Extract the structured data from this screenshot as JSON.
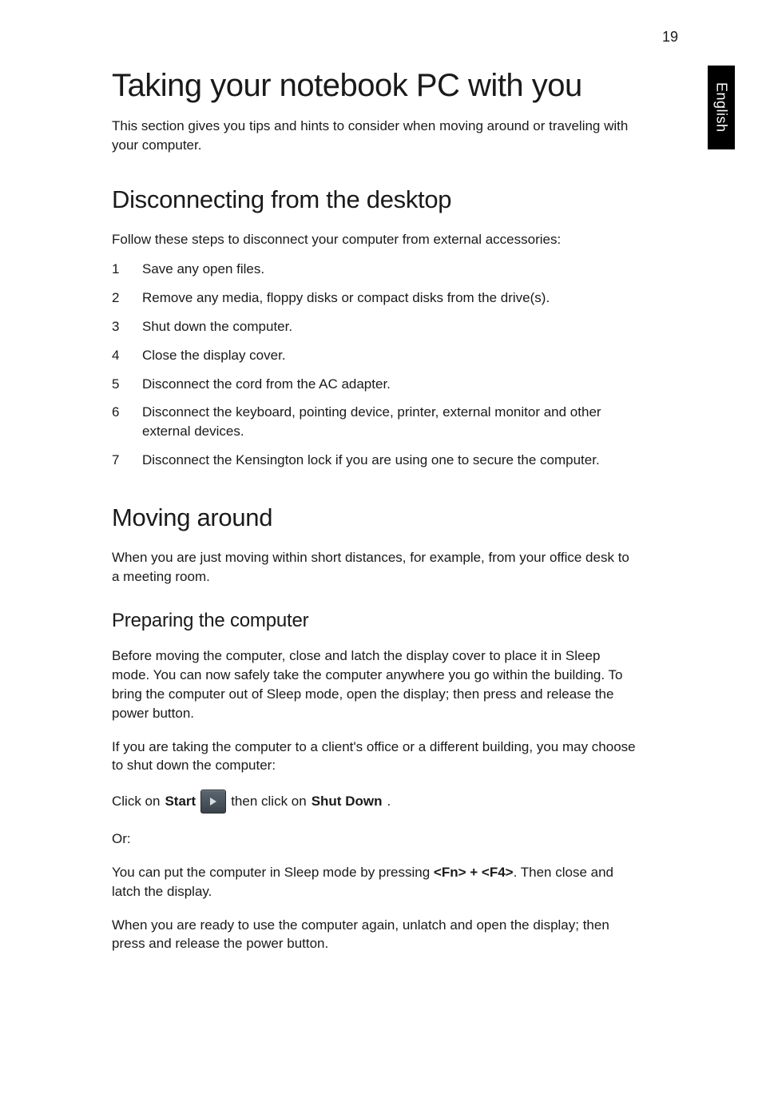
{
  "page_number": "19",
  "side_tab": "English",
  "h1": "Taking your notebook PC with you",
  "intro": "This section gives you tips and hints to consider when moving around or traveling with your computer.",
  "section1": {
    "heading": "Disconnecting from the desktop",
    "lead": "Follow these steps to disconnect your computer from external accessories:",
    "steps": [
      "Save any open files.",
      "Remove any media, floppy disks or compact disks from the drive(s).",
      "Shut down the computer.",
      "Close the display cover.",
      "Disconnect the cord from the AC adapter.",
      "Disconnect the keyboard, pointing device, printer, external monitor and other external devices.",
      "Disconnect the Kensington lock if you are using one to secure the computer."
    ]
  },
  "section2": {
    "heading": "Moving around",
    "lead": "When you are just moving within short distances, for example, from your office desk to a meeting room.",
    "sub": {
      "heading": "Preparing the computer",
      "p1": "Before moving the computer, close and latch the display cover to place it in Sleep mode. You can now safely take the computer anywhere you go within the building. To bring the computer out of Sleep mode, open the display; then press and release the power button.",
      "p2": "If you are taking the computer to a client's office or a different building, you may choose to shut down the computer:",
      "click_on": "Click on ",
      "start_label": "Start",
      "then_click": " then click on ",
      "shutdown_label": "Shut Down",
      "period": ".",
      "or": "Or:",
      "p3_pre": "You can put the computer in Sleep mode by pressing ",
      "fn_key": "<Fn> + <F4>",
      "p3_post": ". Then close and latch the display.",
      "p4": "When you are ready to use the computer again, unlatch and open the display; then press and release the power button."
    }
  }
}
